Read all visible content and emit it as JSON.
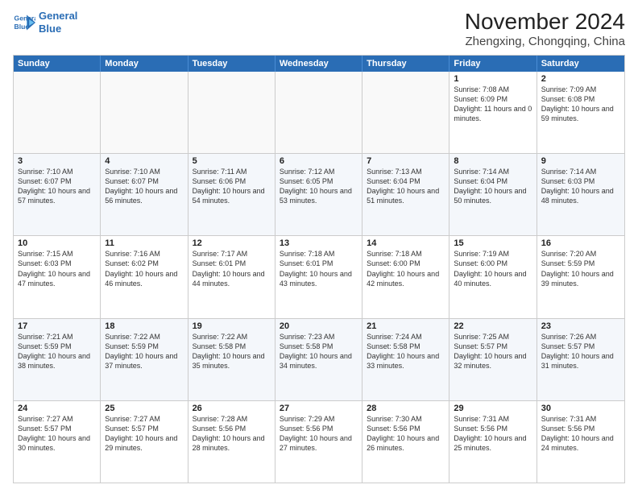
{
  "header": {
    "logo_line1": "General",
    "logo_line2": "Blue",
    "title": "November 2024",
    "subtitle": "Zhengxing, Chongqing, China"
  },
  "days_of_week": [
    "Sunday",
    "Monday",
    "Tuesday",
    "Wednesday",
    "Thursday",
    "Friday",
    "Saturday"
  ],
  "weeks": [
    {
      "alt": false,
      "cells": [
        {
          "day": "",
          "empty": true
        },
        {
          "day": "",
          "empty": true
        },
        {
          "day": "",
          "empty": true
        },
        {
          "day": "",
          "empty": true
        },
        {
          "day": "",
          "empty": true
        },
        {
          "day": "1",
          "sunrise": "7:08 AM",
          "sunset": "6:09 PM",
          "daylight": "11 hours and 0 minutes."
        },
        {
          "day": "2",
          "sunrise": "7:09 AM",
          "sunset": "6:08 PM",
          "daylight": "10 hours and 59 minutes."
        }
      ]
    },
    {
      "alt": true,
      "cells": [
        {
          "day": "3",
          "sunrise": "7:10 AM",
          "sunset": "6:07 PM",
          "daylight": "10 hours and 57 minutes."
        },
        {
          "day": "4",
          "sunrise": "7:10 AM",
          "sunset": "6:07 PM",
          "daylight": "10 hours and 56 minutes."
        },
        {
          "day": "5",
          "sunrise": "7:11 AM",
          "sunset": "6:06 PM",
          "daylight": "10 hours and 54 minutes."
        },
        {
          "day": "6",
          "sunrise": "7:12 AM",
          "sunset": "6:05 PM",
          "daylight": "10 hours and 53 minutes."
        },
        {
          "day": "7",
          "sunrise": "7:13 AM",
          "sunset": "6:04 PM",
          "daylight": "10 hours and 51 minutes."
        },
        {
          "day": "8",
          "sunrise": "7:14 AM",
          "sunset": "6:04 PM",
          "daylight": "10 hours and 50 minutes."
        },
        {
          "day": "9",
          "sunrise": "7:14 AM",
          "sunset": "6:03 PM",
          "daylight": "10 hours and 48 minutes."
        }
      ]
    },
    {
      "alt": false,
      "cells": [
        {
          "day": "10",
          "sunrise": "7:15 AM",
          "sunset": "6:03 PM",
          "daylight": "10 hours and 47 minutes."
        },
        {
          "day": "11",
          "sunrise": "7:16 AM",
          "sunset": "6:02 PM",
          "daylight": "10 hours and 46 minutes."
        },
        {
          "day": "12",
          "sunrise": "7:17 AM",
          "sunset": "6:01 PM",
          "daylight": "10 hours and 44 minutes."
        },
        {
          "day": "13",
          "sunrise": "7:18 AM",
          "sunset": "6:01 PM",
          "daylight": "10 hours and 43 minutes."
        },
        {
          "day": "14",
          "sunrise": "7:18 AM",
          "sunset": "6:00 PM",
          "daylight": "10 hours and 42 minutes."
        },
        {
          "day": "15",
          "sunrise": "7:19 AM",
          "sunset": "6:00 PM",
          "daylight": "10 hours and 40 minutes."
        },
        {
          "day": "16",
          "sunrise": "7:20 AM",
          "sunset": "5:59 PM",
          "daylight": "10 hours and 39 minutes."
        }
      ]
    },
    {
      "alt": true,
      "cells": [
        {
          "day": "17",
          "sunrise": "7:21 AM",
          "sunset": "5:59 PM",
          "daylight": "10 hours and 38 minutes."
        },
        {
          "day": "18",
          "sunrise": "7:22 AM",
          "sunset": "5:59 PM",
          "daylight": "10 hours and 37 minutes."
        },
        {
          "day": "19",
          "sunrise": "7:22 AM",
          "sunset": "5:58 PM",
          "daylight": "10 hours and 35 minutes."
        },
        {
          "day": "20",
          "sunrise": "7:23 AM",
          "sunset": "5:58 PM",
          "daylight": "10 hours and 34 minutes."
        },
        {
          "day": "21",
          "sunrise": "7:24 AM",
          "sunset": "5:58 PM",
          "daylight": "10 hours and 33 minutes."
        },
        {
          "day": "22",
          "sunrise": "7:25 AM",
          "sunset": "5:57 PM",
          "daylight": "10 hours and 32 minutes."
        },
        {
          "day": "23",
          "sunrise": "7:26 AM",
          "sunset": "5:57 PM",
          "daylight": "10 hours and 31 minutes."
        }
      ]
    },
    {
      "alt": false,
      "cells": [
        {
          "day": "24",
          "sunrise": "7:27 AM",
          "sunset": "5:57 PM",
          "daylight": "10 hours and 30 minutes."
        },
        {
          "day": "25",
          "sunrise": "7:27 AM",
          "sunset": "5:57 PM",
          "daylight": "10 hours and 29 minutes."
        },
        {
          "day": "26",
          "sunrise": "7:28 AM",
          "sunset": "5:56 PM",
          "daylight": "10 hours and 28 minutes."
        },
        {
          "day": "27",
          "sunrise": "7:29 AM",
          "sunset": "5:56 PM",
          "daylight": "10 hours and 27 minutes."
        },
        {
          "day": "28",
          "sunrise": "7:30 AM",
          "sunset": "5:56 PM",
          "daylight": "10 hours and 26 minutes."
        },
        {
          "day": "29",
          "sunrise": "7:31 AM",
          "sunset": "5:56 PM",
          "daylight": "10 hours and 25 minutes."
        },
        {
          "day": "30",
          "sunrise": "7:31 AM",
          "sunset": "5:56 PM",
          "daylight": "10 hours and 24 minutes."
        }
      ]
    }
  ]
}
